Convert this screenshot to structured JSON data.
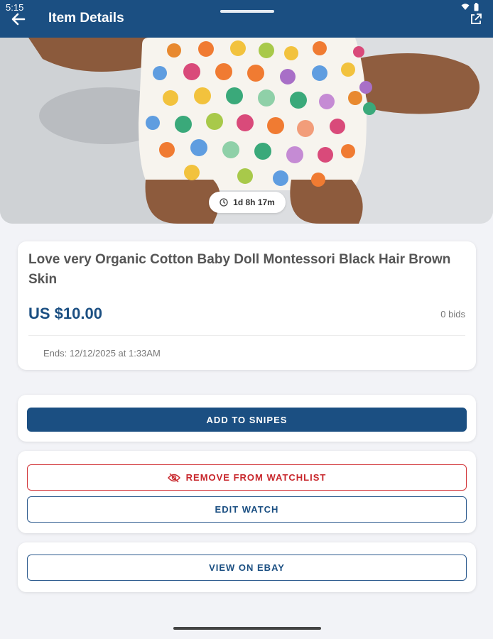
{
  "status_bar": {
    "time": "5:15"
  },
  "header": {
    "title": "Item Details"
  },
  "listing": {
    "time_left": "1d 8h 17m",
    "title": "Love very Organic Cotton Baby Doll Montessori Black Hair Brown Skin",
    "price": "US $10.00",
    "bids": "0 bids",
    "ends": "Ends: 12/12/2025 at 1:33AM"
  },
  "actions": {
    "add_to_snipes": "ADD TO SNIPES",
    "remove_from_watchlist": "REMOVE FROM WATCHLIST",
    "edit_watch": "EDIT WATCH",
    "view_on_ebay": "VIEW ON EBAY"
  },
  "colors": {
    "primary": "#1b4f82",
    "danger": "#c8282d",
    "background": "#f2f3f7"
  },
  "icons": {
    "back": "arrow-left-icon",
    "external": "external-link-icon",
    "clock": "clock-icon",
    "eye_off": "eye-off-icon",
    "wifi": "wifi-icon",
    "battery": "battery-icon"
  }
}
